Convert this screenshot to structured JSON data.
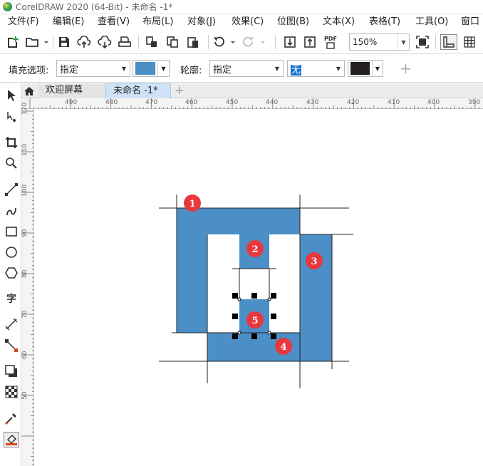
{
  "window": {
    "title": "CorelDRAW 2020 (64-Bit) - 未命名 -1*"
  },
  "menu": [
    "文件(F)",
    "编辑(E)",
    "查看(V)",
    "布局(L)",
    "对象(J)",
    "效果(C)",
    "位图(B)",
    "文本(X)",
    "表格(T)",
    "工具(O)",
    "窗口"
  ],
  "toolbar": {
    "zoom": "150%",
    "pdf_label": "PDF",
    "icons": [
      "new-document-icon",
      "open-folder-icon",
      "save-icon",
      "upload-cloud-icon",
      "download-cloud-icon",
      "print-icon",
      "cut-icon",
      "copy-icon",
      "paste-icon",
      "undo-icon",
      "redo-icon",
      "import-icon",
      "export-icon",
      "publish-pdf-icon",
      "full-screen-icon",
      "rulers-icon",
      "grid-icon"
    ]
  },
  "property_bar": {
    "fill_label": "填充选项:",
    "fill_value": "指定",
    "fill_color": "#4b8fc6",
    "outline_label": "轮廓:",
    "outline_value": "指定",
    "outline_width": "无",
    "outline_color": "#231f1f",
    "add_label": "+"
  },
  "tabs": [
    {
      "label": "欢迎屏幕"
    },
    {
      "label": "未命名 -1*"
    }
  ],
  "tab_add_label": "+",
  "toolbox": {
    "text_tool_label": "字",
    "icons": [
      "pick-tool-icon",
      "shape-tool-icon",
      "crop-tool-icon",
      "zoom-tool-icon",
      "freehand-tool-icon",
      "artistic-media-icon",
      "rectangle-tool-icon",
      "ellipse-tool-icon",
      "polygon-tool-icon",
      "text-tool-icon",
      "parallel-dimension-icon",
      "connector-tool-icon",
      "drop-shadow-icon",
      "transparency-icon",
      "color-eyedropper-icon",
      "interactive-fill-icon"
    ]
  },
  "ruler_top_labels": [
    "490",
    "480",
    "470",
    "460",
    "450",
    "440",
    "430",
    "420",
    "410",
    "400",
    "390"
  ],
  "ruler_left_labels": [
    "120",
    "110",
    "100",
    "90",
    "80",
    "70",
    "60",
    "50"
  ],
  "canvas": {
    "shape_color": "#4b8fc6",
    "marker_color": "#e8383d",
    "markers": [
      "1",
      "2",
      "3",
      "4",
      "5"
    ]
  }
}
